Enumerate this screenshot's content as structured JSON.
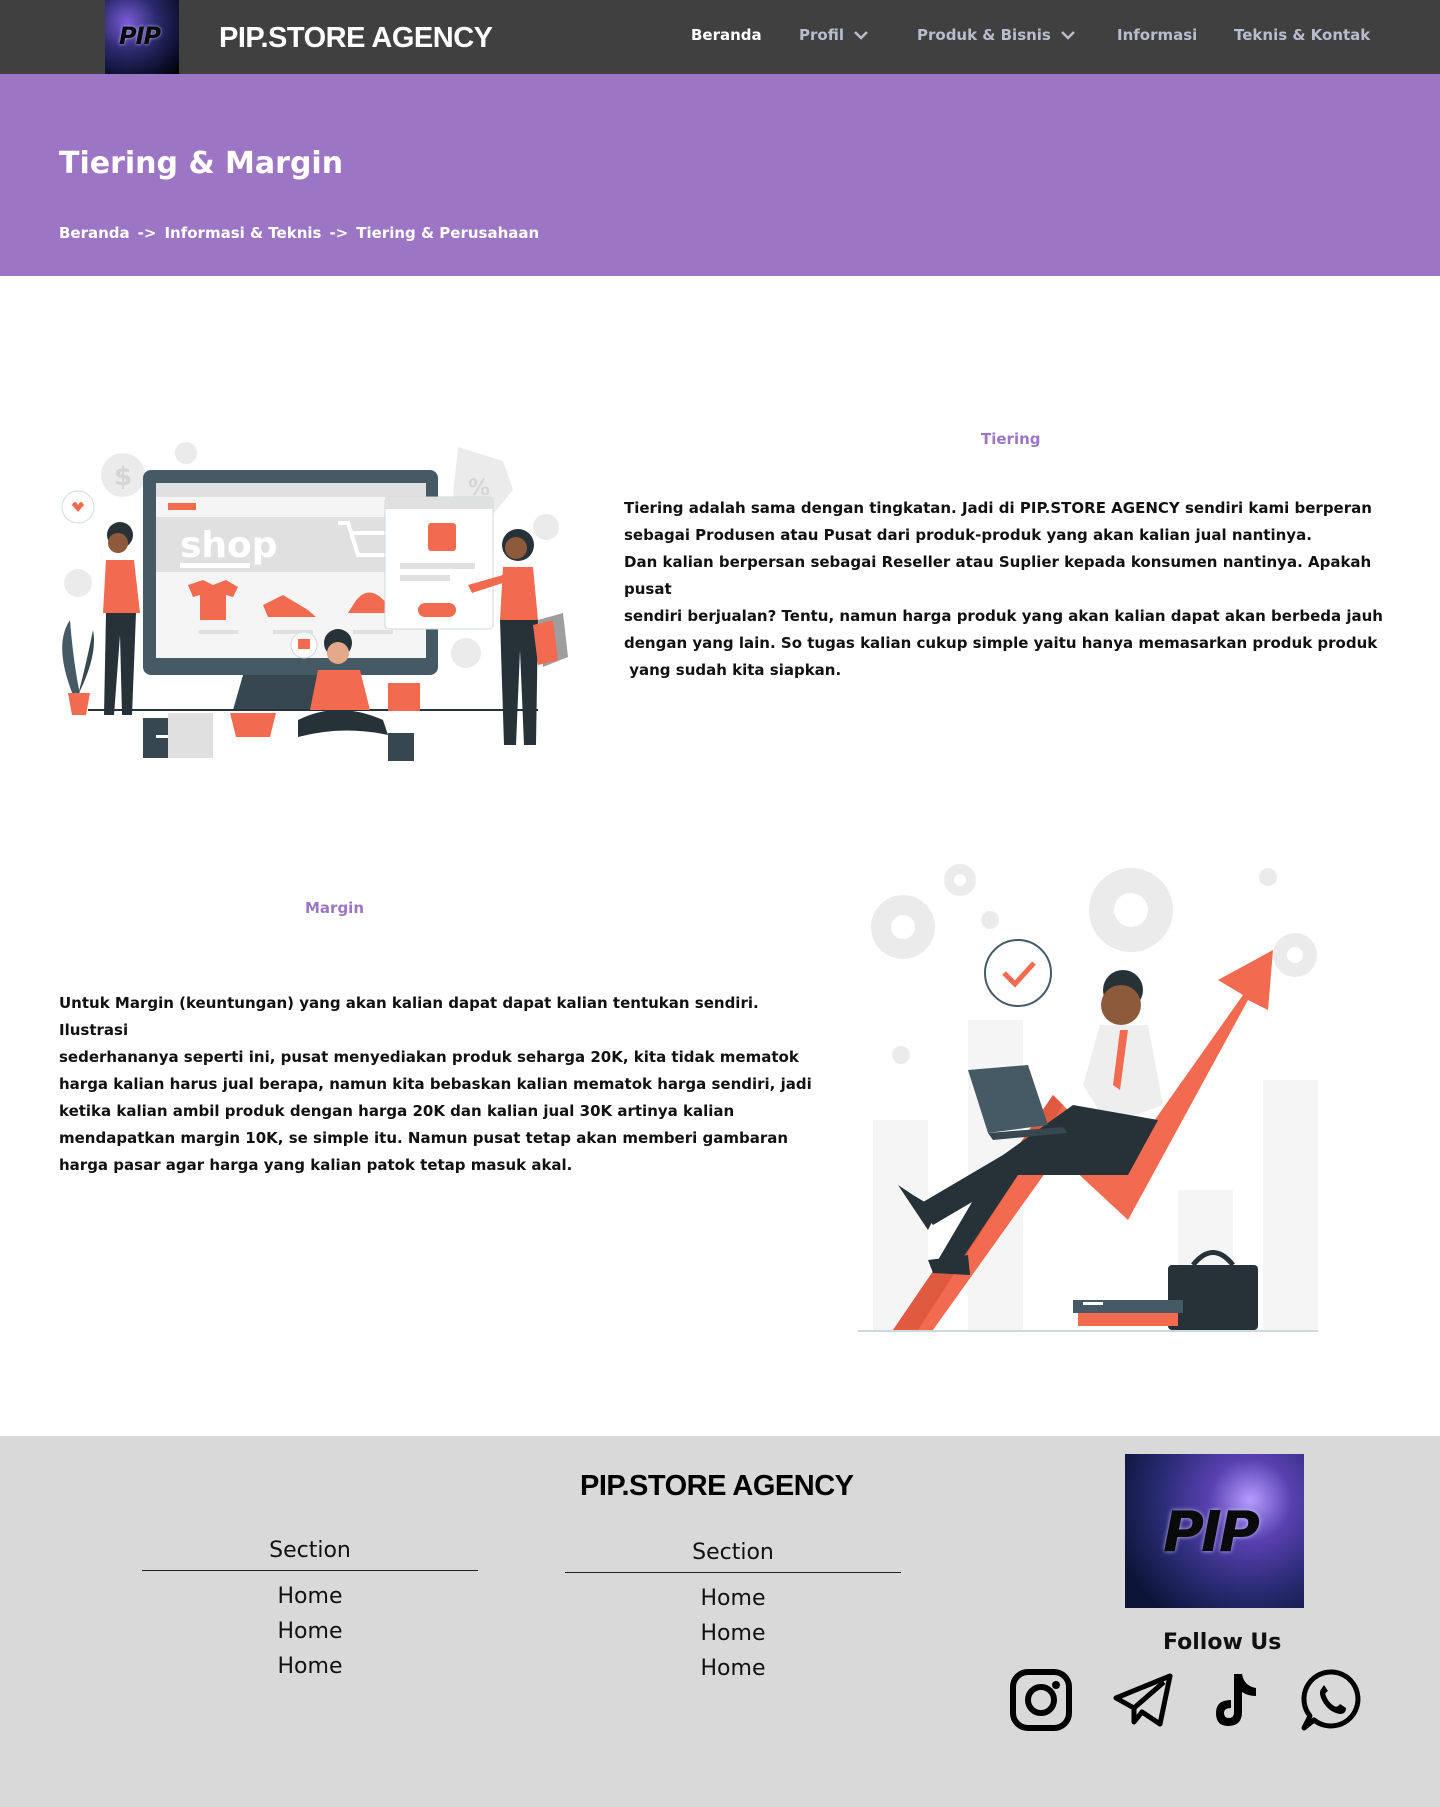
{
  "nav": {
    "logo_text": "PIP",
    "brand": "PIP.STORE AGENCY",
    "items": [
      {
        "label": "Beranda",
        "active": true,
        "dropdown": false
      },
      {
        "label": "Profil",
        "active": false,
        "dropdown": true
      },
      {
        "label": "Produk & Bisnis",
        "active": false,
        "dropdown": true
      },
      {
        "label": "Informasi",
        "active": false,
        "dropdown": false
      },
      {
        "label": "Teknis & Kontak",
        "active": false,
        "dropdown": false
      }
    ]
  },
  "hero": {
    "title": "Tiering & Margin",
    "breadcrumb": [
      "Beranda",
      "->",
      "Informasi & Teknis",
      "->",
      "Tiering & Perusahaan"
    ]
  },
  "tiering": {
    "heading": "Tiering",
    "lines": [
      "Tiering adalah sama dengan tingkatan. Jadi di PIP.STORE AGENCY sendiri kami berperan",
      "sebagai Produsen atau Pusat dari produk-produk yang akan kalian jual nantinya.",
      "Dan kalian berpersan sebagai Reseller atau Suplier kepada konsumen nantinya. Apakah pusat",
      "sendiri berjualan? Tentu, namun harga produk yang akan kalian dapat akan berbeda jauh",
      "dengan yang lain. So tugas kalian cukup simple yaitu hanya memasarkan produk produk",
      " yang sudah kita siapkan."
    ],
    "illustration_text": "shop"
  },
  "margin": {
    "heading": "Margin",
    "lines": [
      "Untuk Margin (keuntungan) yang akan kalian dapat dapat kalian tentukan sendiri. Ilustrasi",
      "sederhananya seperti ini, pusat menyediakan produk seharga 20K, kita tidak mematok",
      "harga kalian harus jual berapa, namun kita bebaskan kalian mematok harga sendiri, jadi",
      "ketika kalian ambil produk dengan harga 20K dan kalian jual 30K artinya kalian",
      "mendapatkan margin 10K, se simple itu. Namun pusat tetap akan memberi gambaran",
      "harga pasar agar harga yang kalian patok tetap masuk akal."
    ]
  },
  "footer": {
    "brand": "PIP.STORE AGENCY",
    "logo_text": "PIP",
    "columns": [
      {
        "title": "Section",
        "links": [
          "Home",
          "Home",
          "Home"
        ]
      },
      {
        "title": "Section",
        "links": [
          "Home",
          "Home",
          "Home"
        ]
      }
    ],
    "follow_label": "Follow Us",
    "social_icons": [
      "instagram-icon",
      "telegram-icon",
      "tiktok-icon",
      "whatsapp-icon"
    ]
  },
  "colors": {
    "navbar": "#404040",
    "hero": "#9c76c4",
    "accent": "#9c76c4",
    "illustration_orange": "#f26b50",
    "illustration_dark": "#263238",
    "footer": "#d9d9d9"
  }
}
